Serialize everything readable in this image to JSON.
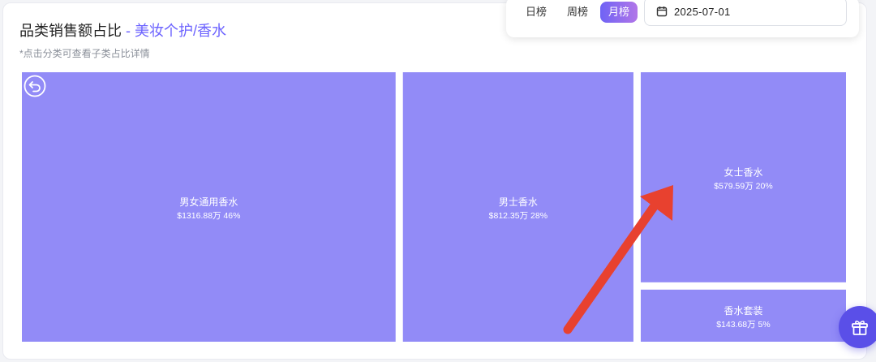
{
  "header": {
    "title": "品类销售额占比",
    "separator": " - ",
    "category_path": "美妆个护/香水",
    "hint": "*点击分类可查看子类占比详情"
  },
  "toolbar": {
    "tabs": [
      {
        "label": "日榜",
        "active": false
      },
      {
        "label": "周榜",
        "active": false
      },
      {
        "label": "月榜",
        "active": true
      }
    ],
    "date": "2025-07-01"
  },
  "colors": {
    "tile": "#928bf7",
    "accent": "#6c63ff",
    "arrow": "#e8412f"
  },
  "icons": {
    "back": "back-arrow-icon",
    "calendar": "calendar-icon",
    "gift": "gift-icon"
  },
  "chart_data": {
    "type": "treemap",
    "title": "品类销售额占比",
    "unit": "万",
    "items": [
      {
        "name": "男女通用香水",
        "value": 1316.88,
        "value_label": "$1316.88万",
        "percent": "46%"
      },
      {
        "name": "男士香水",
        "value": 812.35,
        "value_label": "$812.35万",
        "percent": "28%"
      },
      {
        "name": "女士香水",
        "value": 579.59,
        "value_label": "$579.59万",
        "percent": "20%"
      },
      {
        "name": "香水套装",
        "value": 143.68,
        "value_label": "$143.68万",
        "percent": "5%"
      }
    ]
  }
}
